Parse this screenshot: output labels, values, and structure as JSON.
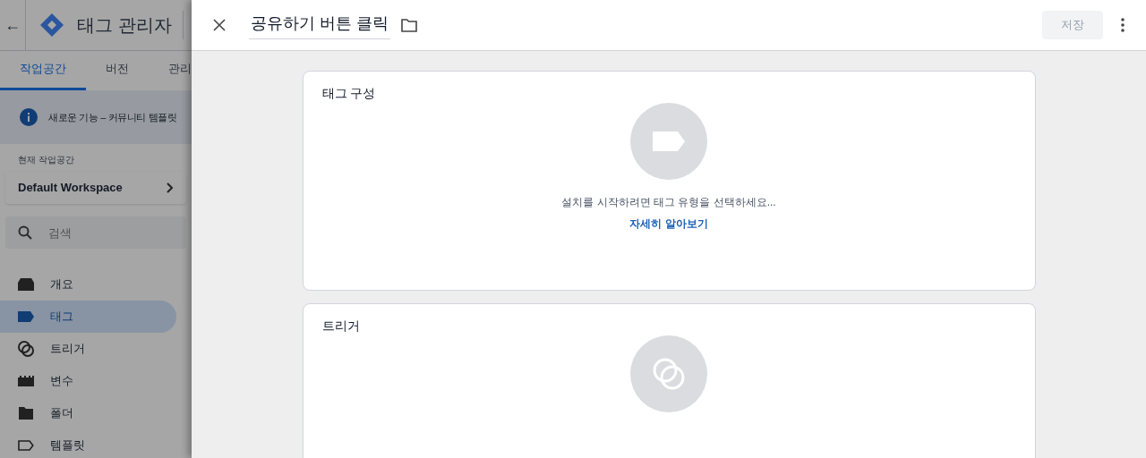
{
  "app": {
    "back": "←",
    "title": "태그 관리자",
    "tabs": [
      {
        "label": "작업공간",
        "selected": true
      },
      {
        "label": "버전",
        "selected": false
      },
      {
        "label": "관리",
        "selected": false
      }
    ],
    "banner": "새로운 기능 – 커뮤니티 템플릿",
    "workspace_label": "현재 작업공간",
    "workspace": "Default Workspace",
    "search": {
      "placeholder": "검색"
    },
    "nav": [
      {
        "label": "개요",
        "kind": "overview",
        "selected": false
      },
      {
        "label": "태그",
        "kind": "tag",
        "selected": true
      },
      {
        "label": "트리거",
        "kind": "trigger",
        "selected": false
      },
      {
        "label": "변수",
        "kind": "variable",
        "selected": false
      },
      {
        "label": "폴더",
        "kind": "folder",
        "selected": false
      },
      {
        "label": "템플릿",
        "kind": "template",
        "selected": false
      }
    ]
  },
  "editor": {
    "name": "공유하기 버튼 클릭",
    "save": {
      "label": "저장",
      "disabled": true
    },
    "cards": [
      {
        "title": "태그 구성",
        "kind": "tag",
        "hint": "설치를 시작하려면 태그 유형을 선택하세요...",
        "link": "자세히 알아보기"
      },
      {
        "title": "트리거",
        "kind": "trigger"
      }
    ]
  }
}
